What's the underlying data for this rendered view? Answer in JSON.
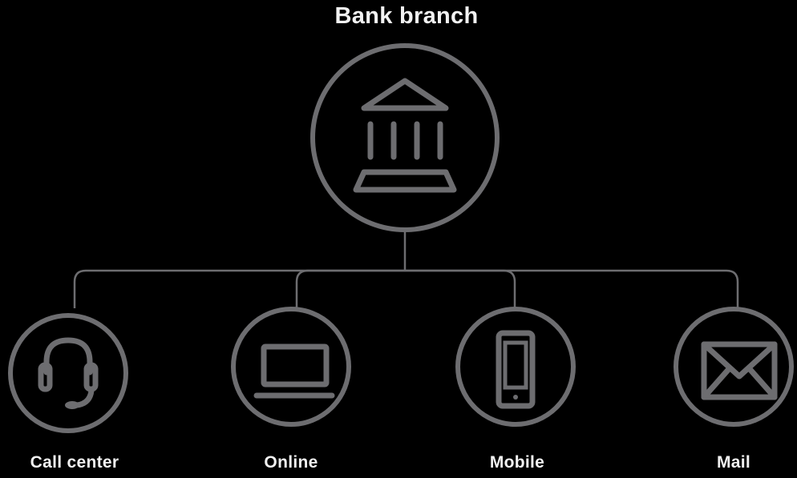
{
  "title": "Bank branch",
  "channels": [
    {
      "label": "Call center",
      "icon": "headset-icon"
    },
    {
      "label": "Online",
      "icon": "laptop-icon"
    },
    {
      "label": "Mobile",
      "icon": "phone-icon"
    },
    {
      "label": "Mail",
      "icon": "envelope-icon"
    }
  ],
  "colors": {
    "background": "#000000",
    "line": "#6d6d70",
    "text": "#f2f2f2"
  }
}
